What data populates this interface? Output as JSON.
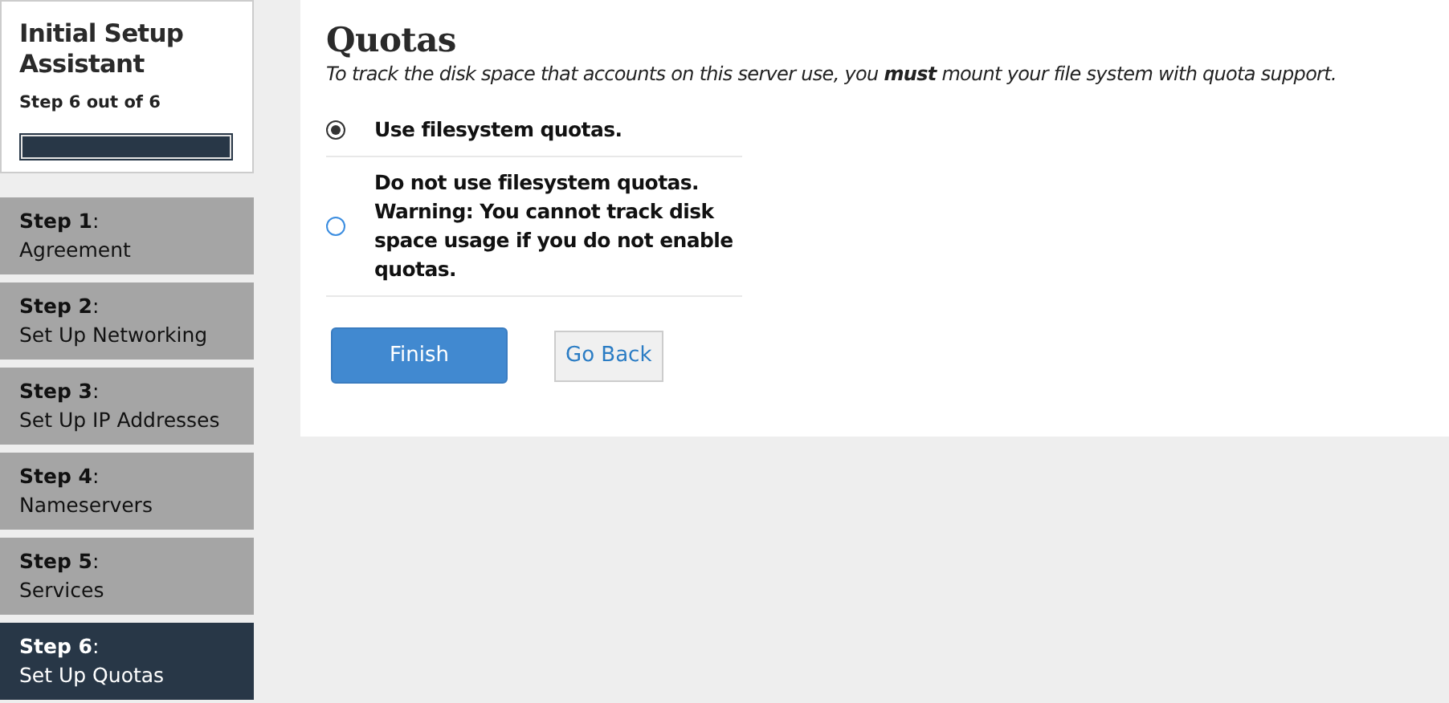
{
  "sidebar": {
    "title": "Initial Setup Assistant",
    "progress_text": "Step 6 out of 6",
    "progress": {
      "level": 1
    },
    "steps": [
      {
        "label": "**Step 1**:",
        "name": "Agreement",
        "selected": false
      },
      {
        "label": "**Step 2**:",
        "name": "Set Up Networking",
        "selected": false
      },
      {
        "label": "**Step 3**:",
        "name": "Set Up IP Addresses",
        "selected": false
      },
      {
        "label": "**Step 4**:",
        "name": "Nameservers",
        "selected": false
      },
      {
        "label": "**Step 5**:",
        "name": "Services",
        "selected": false
      },
      {
        "label": "**Step 6**:",
        "name": "Set Up Quotas",
        "selected": true
      }
    ]
  },
  "main": {
    "title": "Quotas",
    "description": "To track the disk space that accounts on this server use, you **must** mount your file system with quota support.",
    "options": [
      {
        "label": "Use filesystem quotas.",
        "selected": true
      },
      {
        "label": "Do not use filesystem quotas. Warning: You cannot track disk space usage if you do not enable quotas.",
        "selected": false
      }
    ],
    "buttons": {
      "primary": "Finish",
      "secondary": "Go Back"
    }
  }
}
